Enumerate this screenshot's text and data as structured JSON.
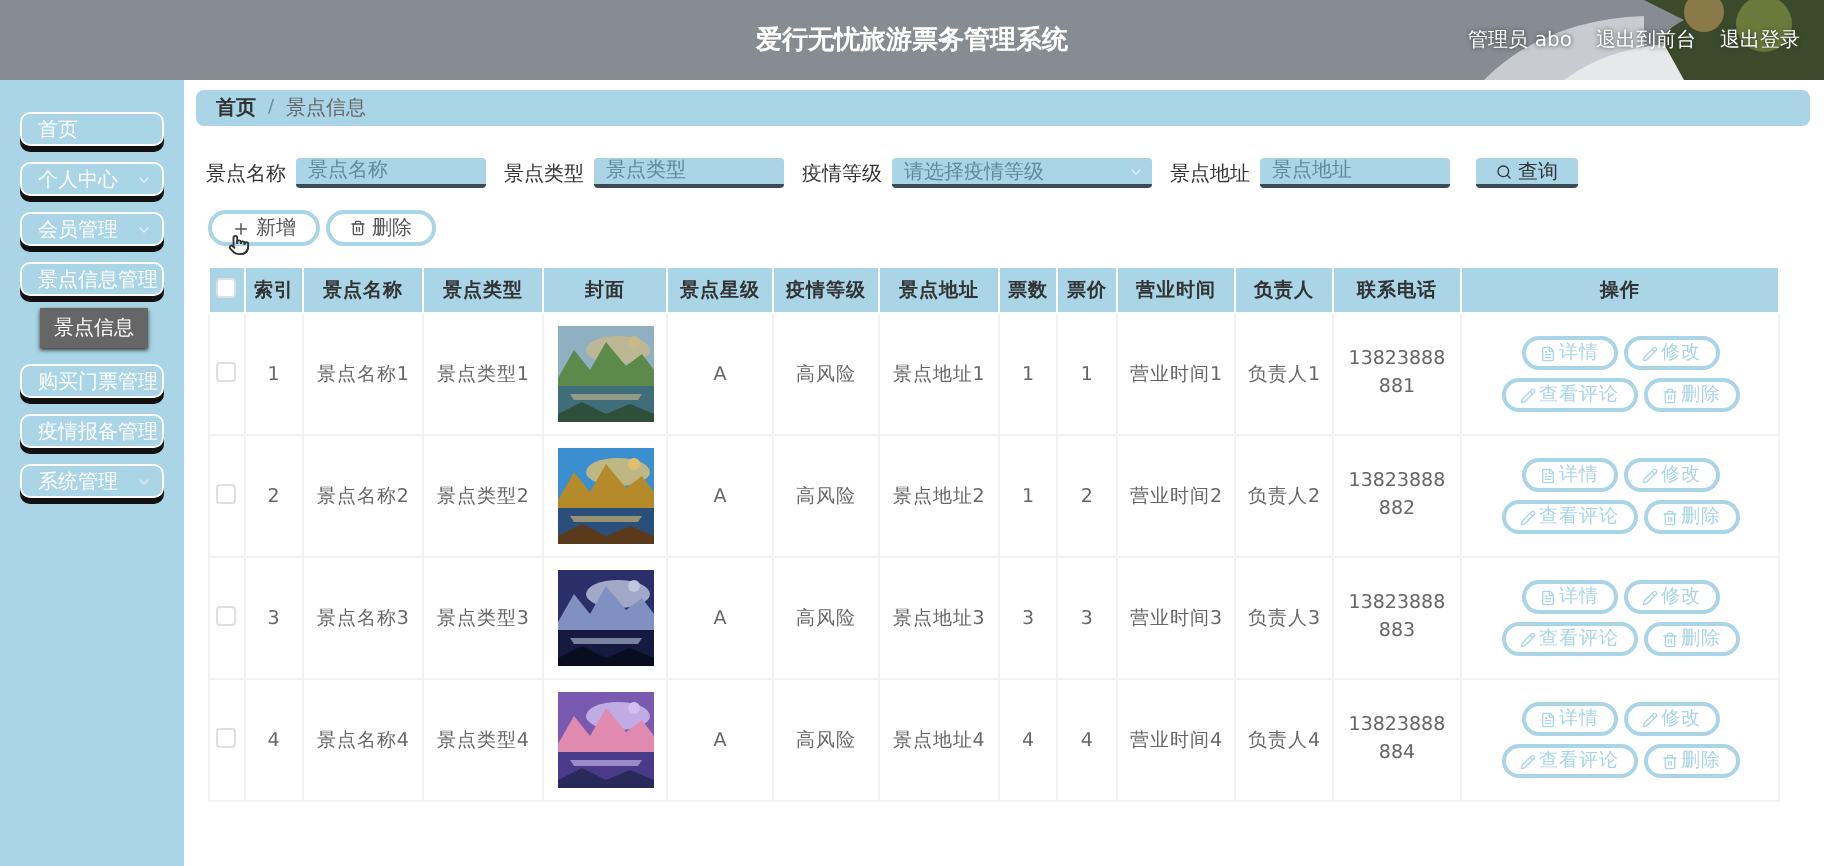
{
  "header": {
    "title": "爱行无忧旅游票务管理系统",
    "user": "管理员 abo",
    "links": [
      "退出到前台",
      "退出登录"
    ]
  },
  "sidebar": {
    "items": [
      {
        "label": "首页",
        "kind": "link"
      },
      {
        "label": "个人中心",
        "kind": "menu"
      },
      {
        "label": "会员管理",
        "kind": "menu"
      },
      {
        "label": "景点信息管理",
        "kind": "menu",
        "expanded": true,
        "children": [
          {
            "label": "景点信息",
            "selected": true
          }
        ]
      },
      {
        "label": "购买门票管理",
        "kind": "menu"
      },
      {
        "label": "疫情报备管理",
        "kind": "menu"
      },
      {
        "label": "系统管理",
        "kind": "menu"
      }
    ]
  },
  "breadcrumb": {
    "separator": "/",
    "items": [
      "首页",
      "景点信息"
    ]
  },
  "search": {
    "fields": [
      {
        "label": "景点名称",
        "placeholder": "景点名称",
        "kind": "input"
      },
      {
        "label": "景点类型",
        "placeholder": "景点类型",
        "kind": "input"
      },
      {
        "label": "疫情等级",
        "placeholder": "请选择疫情等级",
        "kind": "select"
      },
      {
        "label": "景点地址",
        "placeholder": "景点地址",
        "kind": "input"
      }
    ],
    "button": "查询"
  },
  "actions": [
    {
      "label": "新增",
      "kind": "add"
    },
    {
      "label": "删除",
      "kind": "delete"
    }
  ],
  "table": {
    "all_checked": false,
    "columns": [
      "索引",
      "景点名称",
      "景点类型",
      "封面",
      "景点星级",
      "疫情等级",
      "景点地址",
      "票数",
      "票价",
      "营业时间",
      "负责人",
      "联系电话",
      "操作"
    ],
    "rows": [
      {
        "checked": false,
        "cells": [
          "1",
          "景点名称1",
          "景点类型1",
          null,
          "A",
          "高风险",
          "景点地址1",
          "1",
          "1",
          "营业时间1",
          "负责人1",
          "13823888881"
        ],
        "actions": [
          {
            "label": "详情",
            "kind": "detail"
          },
          {
            "label": "修改",
            "kind": "edit"
          },
          {
            "label": "查看评论",
            "kind": "edit"
          },
          {
            "label": "删除",
            "kind": "delete"
          }
        ]
      },
      {
        "checked": false,
        "cells": [
          "2",
          "景点名称2",
          "景点类型2",
          null,
          "A",
          "高风险",
          "景点地址2",
          "1",
          "2",
          "营业时间2",
          "负责人2",
          "13823888882"
        ],
        "actions": [
          {
            "label": "详情",
            "kind": "detail"
          },
          {
            "label": "修改",
            "kind": "edit"
          },
          {
            "label": "查看评论",
            "kind": "edit"
          },
          {
            "label": "删除",
            "kind": "delete"
          }
        ]
      },
      {
        "checked": false,
        "cells": [
          "3",
          "景点名称3",
          "景点类型3",
          null,
          "A",
          "高风险",
          "景点地址3",
          "3",
          "3",
          "营业时间3",
          "负责人3",
          "13823888883"
        ],
        "actions": [
          {
            "label": "详情",
            "kind": "detail"
          },
          {
            "label": "修改",
            "kind": "edit"
          },
          {
            "label": "查看评论",
            "kind": "edit"
          },
          {
            "label": "删除",
            "kind": "delete"
          }
        ]
      },
      {
        "checked": false,
        "cells": [
          "4",
          "景点名称4",
          "景点类型4",
          null,
          "A",
          "高风险",
          "景点地址4",
          "4",
          "4",
          "营业时间4",
          "负责人4",
          "13823888884"
        ],
        "actions": [
          {
            "label": "详情",
            "kind": "detail"
          },
          {
            "label": "修改",
            "kind": "edit"
          },
          {
            "label": "查看评论",
            "kind": "edit"
          },
          {
            "label": "删除",
            "kind": "delete"
          }
        ]
      }
    ]
  }
}
